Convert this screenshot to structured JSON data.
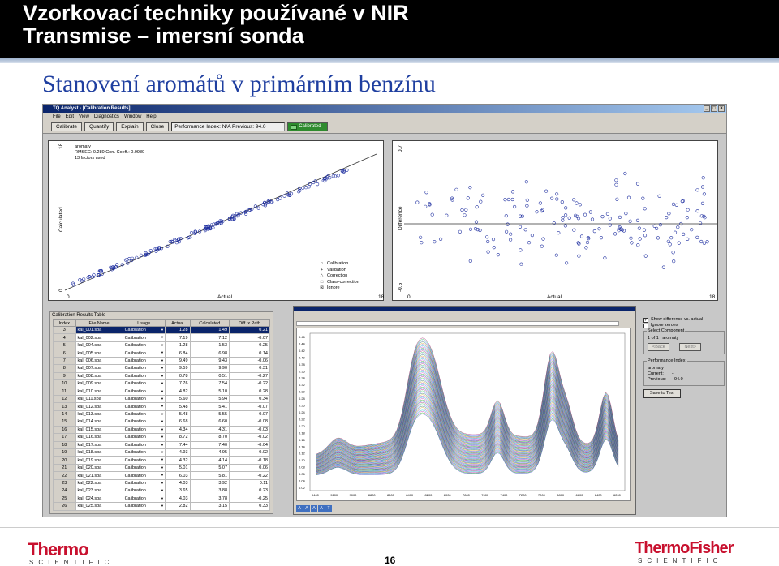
{
  "slide": {
    "title_line1": "Vzorkovací techniky používané v NIR",
    "title_line2": "Transmise – imersní sonda",
    "subtitle": "Stanovení aromátů v primárním benzínu",
    "page_number": "16"
  },
  "app": {
    "window_title": "TQ Analyst - [Calibration Results]",
    "menu": [
      "File",
      "Edit",
      "View",
      "Diagnostics",
      "Window",
      "Help"
    ],
    "toolbar": {
      "calibrate": "Calibrate",
      "quantify": "Quantify",
      "explain": "Explain",
      "close": "Close",
      "performance": "Performance Index:  N/A  Previous:  94.0",
      "status": "Calibrated"
    },
    "cal_plot": {
      "component": "aromaty",
      "stats": "RMSEC: 0.280    Corr. Coeff.: 0.9980",
      "factors": "13 factors used",
      "ylabel": "Calculated",
      "xlabel": "Actual",
      "x_min": "0",
      "x_max": "18",
      "y_min": "0",
      "y_max": "18"
    },
    "diff_plot": {
      "ylabel": "Difference",
      "xlabel": "Actual",
      "y_max": "0.7",
      "y_min": "-0.5",
      "x_min": "0",
      "x_max": "18"
    },
    "legend": [
      "Calibration",
      "Validation",
      "Correction",
      "Class-correction",
      "Ignore"
    ],
    "table": {
      "title": "Calibration Results Table",
      "columns": [
        "Index",
        "File Name",
        "Usage",
        "Actual",
        "Calculated",
        "Diff. x Path"
      ],
      "rows": [
        [
          "3",
          "kal_001.spa",
          "Calibration",
          "1.28",
          "1.49",
          "0.21"
        ],
        [
          "4",
          "kal_002.spa",
          "Calibration",
          "7.19",
          "7.12",
          "-0.07"
        ],
        [
          "5",
          "kal_004.spa",
          "Calibration",
          "1.28",
          "1.53",
          "0.25"
        ],
        [
          "6",
          "kal_005.spa",
          "Calibration",
          "6.84",
          "6.98",
          "0.14"
        ],
        [
          "7",
          "kal_006.spa",
          "Calibration",
          "9.49",
          "9.43",
          "-0.06"
        ],
        [
          "8",
          "kal_007.spa",
          "Calibration",
          "9.59",
          "9.90",
          "0.31"
        ],
        [
          "9",
          "kal_008.spa",
          "Calibration",
          "0.78",
          "0.51",
          "-0.27"
        ],
        [
          "10",
          "kal_009.spa",
          "Calibration",
          "7.76",
          "7.54",
          "-0.22"
        ],
        [
          "11",
          "kal_010.spa",
          "Calibration",
          "4.82",
          "5.10",
          "0.28"
        ],
        [
          "12",
          "kal_011.spa",
          "Calibration",
          "5.60",
          "5.94",
          "0.34"
        ],
        [
          "13",
          "kal_012.spa",
          "Calibration",
          "5.48",
          "5.41",
          "-0.07"
        ],
        [
          "14",
          "kal_013.spa",
          "Calibration",
          "5.48",
          "5.55",
          "0.07"
        ],
        [
          "15",
          "kal_014.spa",
          "Calibration",
          "6.68",
          "6.60",
          "-0.08"
        ],
        [
          "16",
          "kal_015.spa",
          "Calibration",
          "4.34",
          "4.31",
          "-0.03"
        ],
        [
          "17",
          "kal_016.spa",
          "Calibration",
          "8.72",
          "8.70",
          "-0.02"
        ],
        [
          "18",
          "kal_017.spa",
          "Calibration",
          "7.44",
          "7.40",
          "-0.04"
        ],
        [
          "19",
          "kal_018.spa",
          "Calibration",
          "4.93",
          "4.95",
          "0.02"
        ],
        [
          "20",
          "kal_019.spa",
          "Calibration",
          "4.32",
          "4.14",
          "-0.18"
        ],
        [
          "21",
          "kal_020.spa",
          "Calibration",
          "5.01",
          "5.07",
          "0.06"
        ],
        [
          "22",
          "kal_021.spa",
          "Calibration",
          "6.03",
          "5.81",
          "-0.22"
        ],
        [
          "23",
          "kal_022.spa",
          "Calibration",
          "4.03",
          "3.92",
          "0.11"
        ],
        [
          "24",
          "kal_023.spa",
          "Calibration",
          "3.65",
          "3.88",
          "0.23"
        ],
        [
          "25",
          "kal_024.spa",
          "Calibration",
          "4.03",
          "3.78",
          "-0.25"
        ],
        [
          "26",
          "kal_025.spa",
          "Calibration",
          "2.82",
          "3.15",
          "0.33"
        ]
      ]
    },
    "right_panel": {
      "show_diff": "Show difference vs. actual",
      "ignore_zeroes": "Ignore zeroes",
      "select_component": "Select Component",
      "component_count": "1 of 1",
      "component_name": "aromaty",
      "back": "<Back",
      "next": "Next>",
      "perf_title": "Performance Index:",
      "perf_component": "aromaty",
      "current_label": "Current:",
      "current_value": "-",
      "previous_label": "Previous:",
      "previous_value": "94.0",
      "save": "Save to Text"
    },
    "spectra": {
      "y_ticks": [
        "0.46",
        "0.44",
        "0.42",
        "0.40",
        "0.38",
        "0.36",
        "0.34",
        "0.32",
        "0.30",
        "0.28",
        "0.26",
        "0.24",
        "0.22",
        "0.20",
        "0.18",
        "0.16",
        "0.14",
        "0.12",
        "0.10",
        "0.08",
        "0.06",
        "0.04",
        "0.02"
      ],
      "x_ticks": [
        "9400",
        "9200",
        "9000",
        "8800",
        "8600",
        "8400",
        "8200",
        "8000",
        "7800",
        "7600",
        "7400",
        "7200",
        "7000",
        "6800",
        "6600",
        "6400",
        "6200"
      ]
    }
  },
  "footer": {
    "logo_left": "Thermo",
    "logo_left_sub": "SCIENTIFIC",
    "logo_right": "ThermoFisher",
    "logo_right_sub": "SCIENTIFIC"
  }
}
